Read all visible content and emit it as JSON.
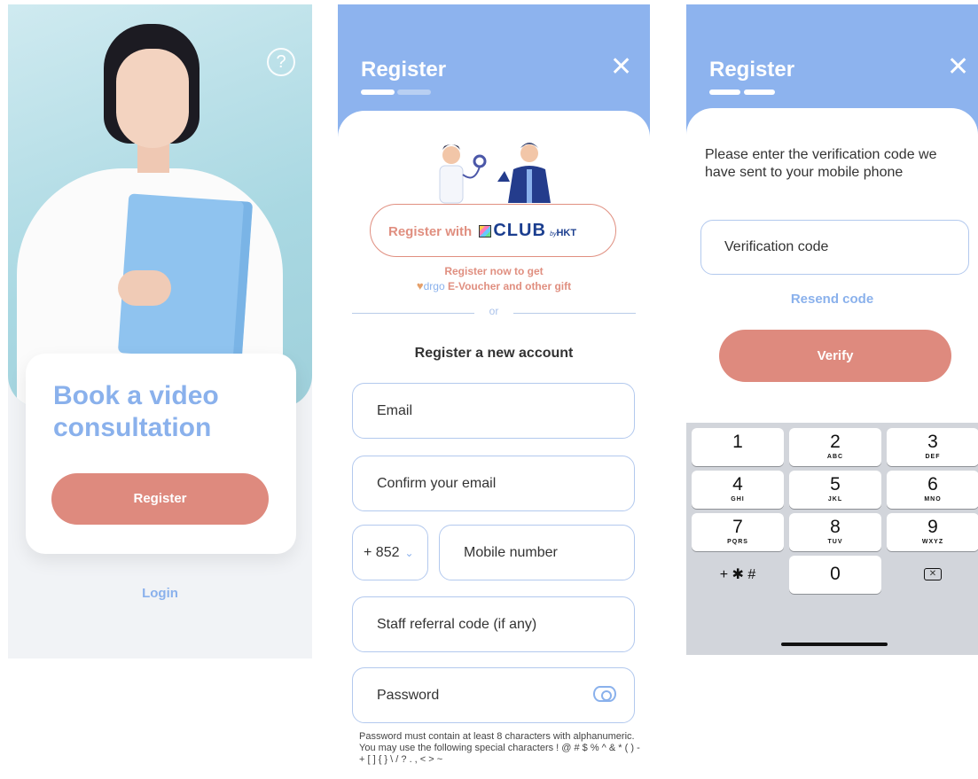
{
  "screen1": {
    "help_icon": "?",
    "headline": "Book a video consultation",
    "register_button": "Register",
    "login_link": "Login"
  },
  "screen2": {
    "title": "Register",
    "close_icon": "✕",
    "club_button": {
      "prefix": "Register with",
      "brand": "CLUB",
      "by": "by",
      "partner": "HKT"
    },
    "promo_line1": "Register now to get",
    "promo_brand": "drgo",
    "promo_line2": "E-Voucher and other gift",
    "or": "or",
    "section_title": "Register a new account",
    "fields": {
      "email": "Email",
      "confirm_email": "Confirm your email",
      "country_code": "+ 852",
      "mobile": "Mobile number",
      "referral": "Staff referral code (if any)",
      "password": "Password"
    },
    "password_hint": "Password must contain at least 8 characters with alphanumeric. You may use the following special characters ! @ # $ % ^ & * ( ) - + [ ] { } \\ / ? . , < > ~"
  },
  "screen3": {
    "title": "Register",
    "close_icon": "✕",
    "instruction": "Please enter the verification code we have sent to your mobile phone",
    "code_placeholder": "Verification code",
    "resend": "Resend code",
    "verify_button": "Verify",
    "keys": [
      {
        "d": "1",
        "l": ""
      },
      {
        "d": "2",
        "l": "ABC"
      },
      {
        "d": "3",
        "l": "DEF"
      },
      {
        "d": "4",
        "l": "GHI"
      },
      {
        "d": "5",
        "l": "JKL"
      },
      {
        "d": "6",
        "l": "MNO"
      },
      {
        "d": "7",
        "l": "PQRS"
      },
      {
        "d": "8",
        "l": "TUV"
      },
      {
        "d": "9",
        "l": "WXYZ"
      }
    ],
    "symbols_key": "+ ✱ #",
    "zero_key": "0",
    "backspace_glyph": "✕"
  },
  "colors": {
    "accent_blue": "#8ab1ec",
    "header_blue": "#8db3ee",
    "salmon": "#de8a7e"
  }
}
